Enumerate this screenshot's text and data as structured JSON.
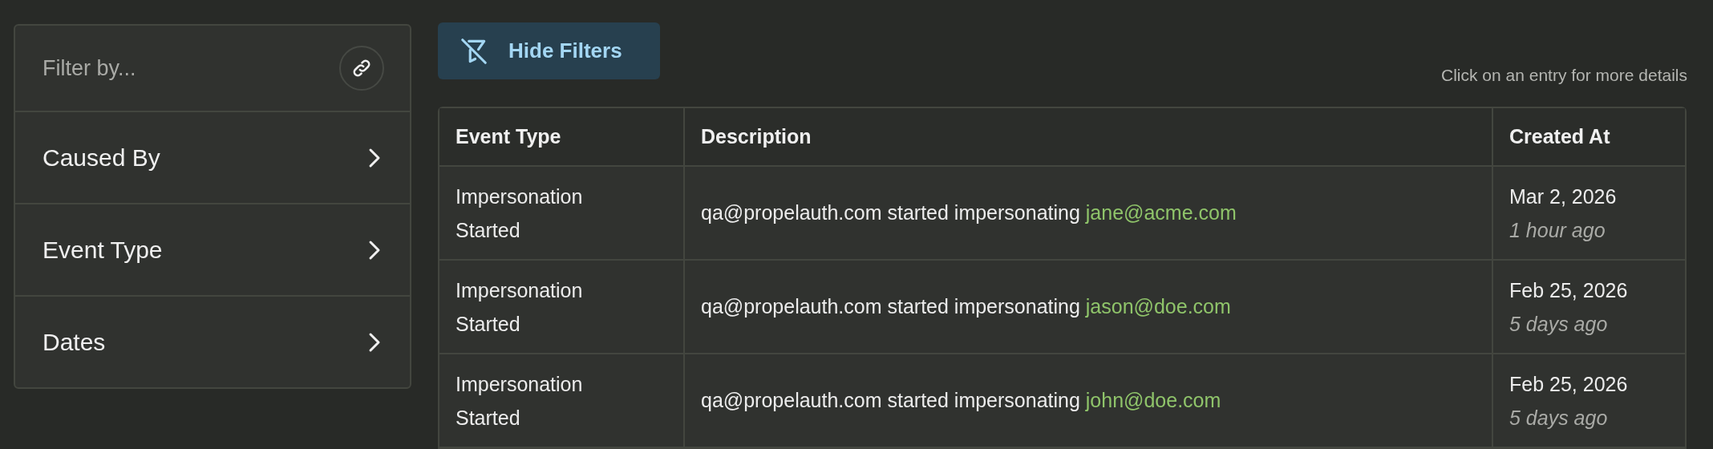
{
  "filter_panel": {
    "placeholder": "Filter by...",
    "items": [
      {
        "label": "Caused By",
        "expanded": false
      },
      {
        "label": "Event Type",
        "expanded": false
      },
      {
        "label": "Dates",
        "expanded": false
      }
    ]
  },
  "toolbar": {
    "button": "Hide Filters",
    "hint": "Click on an entry for more details"
  },
  "table": {
    "columns": [
      "Event Type",
      "Description",
      "Created At"
    ],
    "rows": [
      {
        "event_type": "Impersonation Started",
        "description": "qa@propelauth.com started impersonating",
        "target": "jane@acme.com",
        "date": "Mar 2, 2026",
        "relative": "1 hour ago"
      },
      {
        "event_type": "Impersonation Started",
        "description": "qa@propelauth.com started impersonating",
        "target": "jason@doe.com",
        "date": "Feb 25, 2026",
        "relative": "5 days ago"
      },
      {
        "event_type": "Impersonation Started",
        "description": "qa@propelauth.com started impersonating",
        "target": "john@doe.com",
        "date": "Feb 25, 2026",
        "relative": "5 days ago"
      }
    ]
  }
}
